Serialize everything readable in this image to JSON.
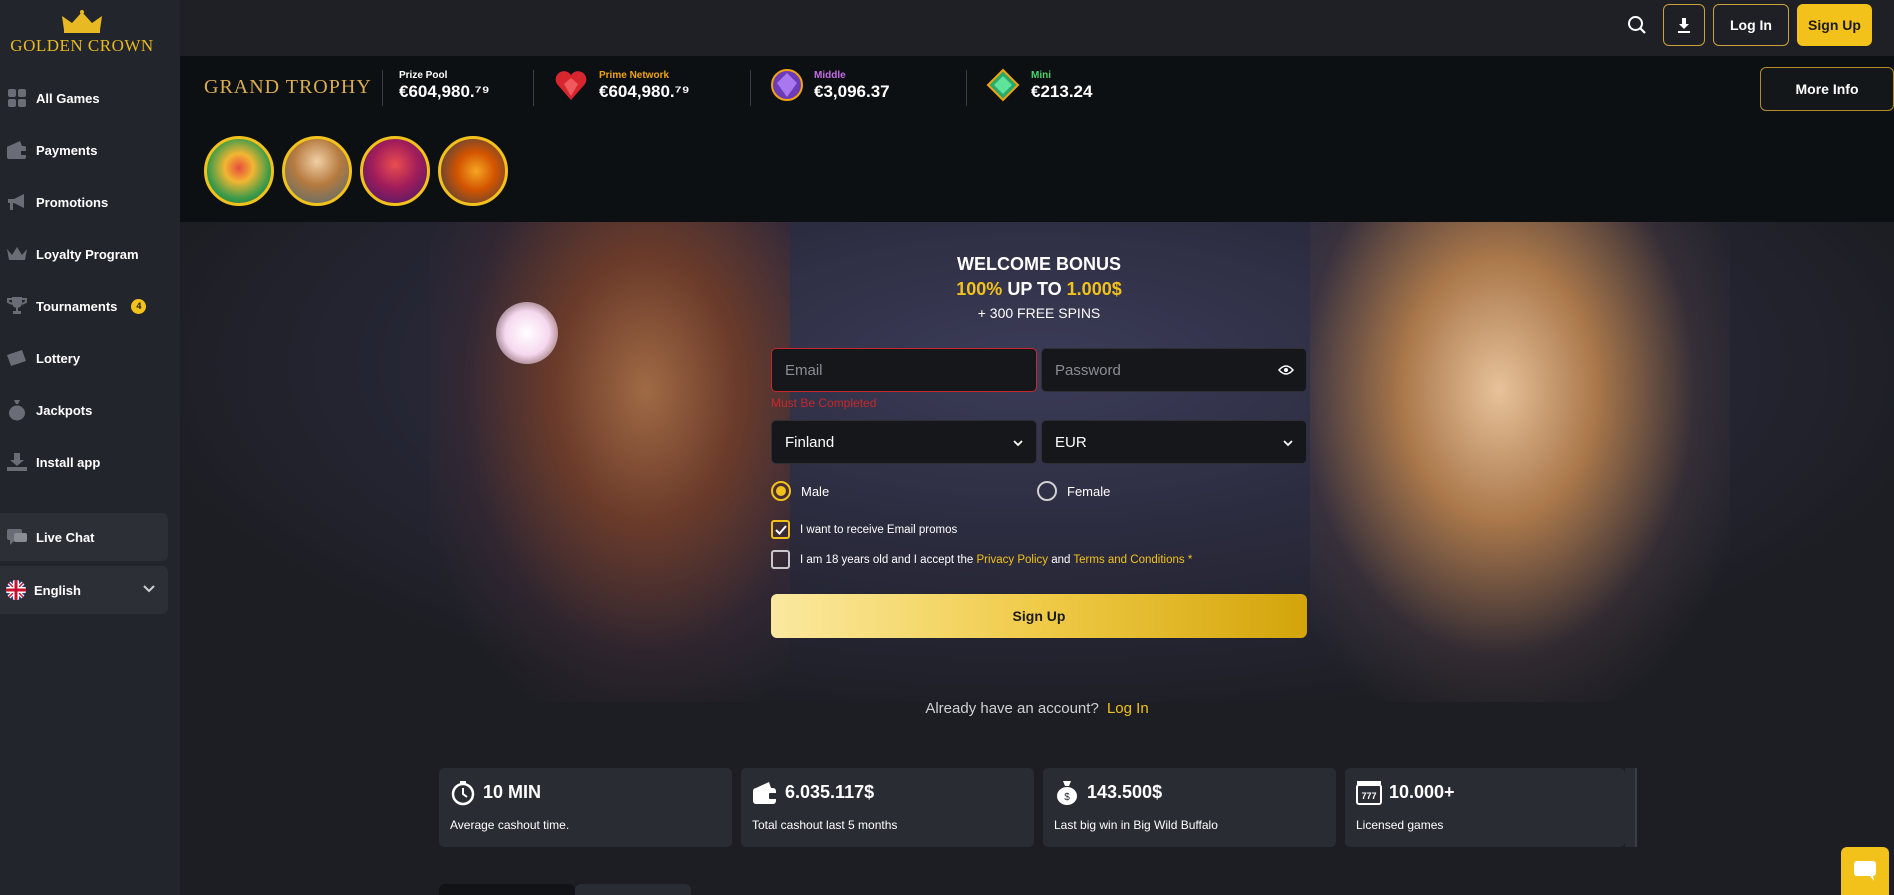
{
  "brand": {
    "name": "GOLDEN CROWN"
  },
  "sidebar": {
    "items": [
      {
        "label": "All Games",
        "icon": "grid-icon"
      },
      {
        "label": "Payments",
        "icon": "wallet-icon"
      },
      {
        "label": "Promotions",
        "icon": "megaphone-icon"
      },
      {
        "label": "Loyalty Program",
        "icon": "crown-icon"
      },
      {
        "label": "Tournaments",
        "icon": "trophy-icon",
        "badge": "4"
      },
      {
        "label": "Lottery",
        "icon": "ticket-icon"
      },
      {
        "label": "Jackpots",
        "icon": "money-bag-icon"
      },
      {
        "label": "Install app",
        "icon": "download-icon"
      }
    ],
    "live_chat": "Live Chat",
    "language": "English"
  },
  "header": {
    "login": "Log In",
    "signup": "Sign Up"
  },
  "jackpots": {
    "title": "GRAND TROPHY",
    "items": [
      {
        "label": "Prize Pool",
        "value": "€604,980.⁷⁹",
        "label_color": "#ffffff"
      },
      {
        "label": "Prime Network",
        "value": "€604,980.⁷⁹",
        "label_color": "#f2a40f"
      },
      {
        "label": "Middle",
        "value": "€3,096.37",
        "label_color": "#c46be8"
      },
      {
        "label": "Mini",
        "value": "€213.24",
        "label_color": "#49d36b"
      }
    ],
    "more_info": "More Info"
  },
  "bonus": {
    "line1": "WELCOME BONUS",
    "percent": "100%",
    "up_to": " UP TO ",
    "amount": "1.000$",
    "line3": "+ 300 FREE SPINS"
  },
  "form": {
    "email_placeholder": "Email",
    "password_placeholder": "Password",
    "error": "Must Be Completed",
    "country": "Finland",
    "currency": "EUR",
    "gender_male": "Male",
    "gender_female": "Female",
    "promo_label": "I want to receive Email promos",
    "terms_pre": "I am 18 years old and I accept the ",
    "privacy": "Privacy Policy",
    "and": " and ",
    "terms": "Terms and Conditions",
    "star": " *",
    "submit": "Sign Up"
  },
  "already": {
    "text": "Already have an account?",
    "link": "Log In"
  },
  "stats": [
    {
      "value": "10 MIN",
      "label": "Average cashout time.",
      "icon": "stopwatch-icon"
    },
    {
      "value": "6.035.117$",
      "label": "Total cashout last 5 months",
      "icon": "wallet-icon"
    },
    {
      "value": "143.500$",
      "label": "Last big win in Big Wild Buffalo",
      "icon": "money-bag-icon"
    },
    {
      "value": "10.000+",
      "label": "Licensed games",
      "icon": "slot-machine-icon"
    }
  ],
  "colors": {
    "accent": "#f2c21b",
    "error": "#c4282b",
    "bg": "#1d1e24"
  }
}
